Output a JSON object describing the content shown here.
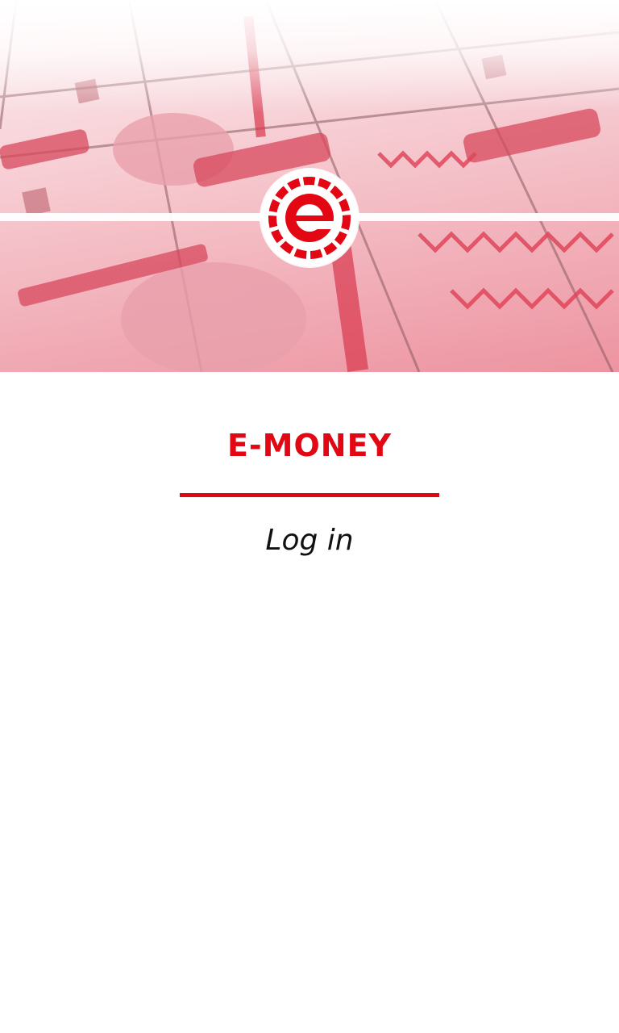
{
  "app": {
    "title": "E-MONEY",
    "brand_color": "#e30613"
  },
  "hero": {
    "image_description_icon": "banknote-collage-image",
    "logo_icon": "e-logo-icon"
  },
  "actions": {
    "login_label": "Log in"
  }
}
